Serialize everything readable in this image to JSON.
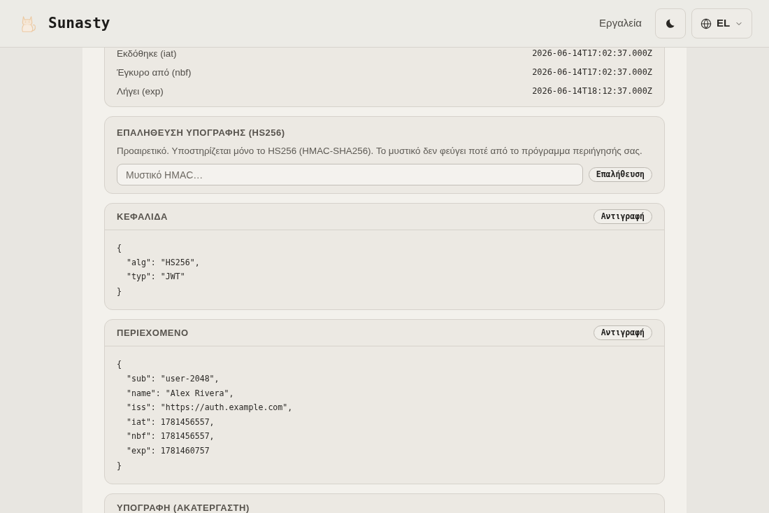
{
  "header": {
    "brand": "Sunasty",
    "nav_link": "Εργαλεία",
    "language": "EL"
  },
  "claims": [
    {
      "label": "Εκδόθηκε (iat)",
      "value": "2026-06-14T17:02:37.000Z"
    },
    {
      "label": "Έγκυρο από (nbf)",
      "value": "2026-06-14T17:02:37.000Z"
    },
    {
      "label": "Λήγει (exp)",
      "value": "2026-06-14T18:12:37.000Z"
    }
  ],
  "verify": {
    "title": "ΕΠΑΛΗΘΕΥΣΗ ΥΠΟΓΡΑΦΗΣ (HS256)",
    "description": "Προαιρετικό. Υποστηρίζεται μόνο το HS256 (HMAC-SHA256). Το μυστικό δεν φεύγει ποτέ από το πρόγραμμα περιήγησής σας.",
    "secret_field": {
      "placeholder": "Μυστικό HMAC…"
    },
    "button": "Επαλήθευση"
  },
  "sections": [
    {
      "title": "ΚΕΦΑΛΙΔΑ",
      "copy_button": "Αντιγραφή",
      "code": [
        "{",
        "  \"alg\": \"HS256\",",
        "  \"typ\": \"JWT\"",
        "}"
      ]
    },
    {
      "title": "ΠΕΡΙΕΧΟΜΕΝΟ",
      "copy_button": "Αντιγραφή",
      "code": [
        "{",
        "  \"sub\": \"user-2048\",",
        "  \"name\": \"Alex Rivera\",",
        "  \"iss\": \"https://auth.example.com\",",
        "  \"iat\": 1781456557,",
        "  \"nbf\": 1781456557,",
        "  \"exp\": 1781460757",
        "}"
      ]
    },
    {
      "title": "ΥΠΟΓΡΑΦΗ (ΑΚΑΤΕΡΓΑΣΤΗ)"
    }
  ]
}
